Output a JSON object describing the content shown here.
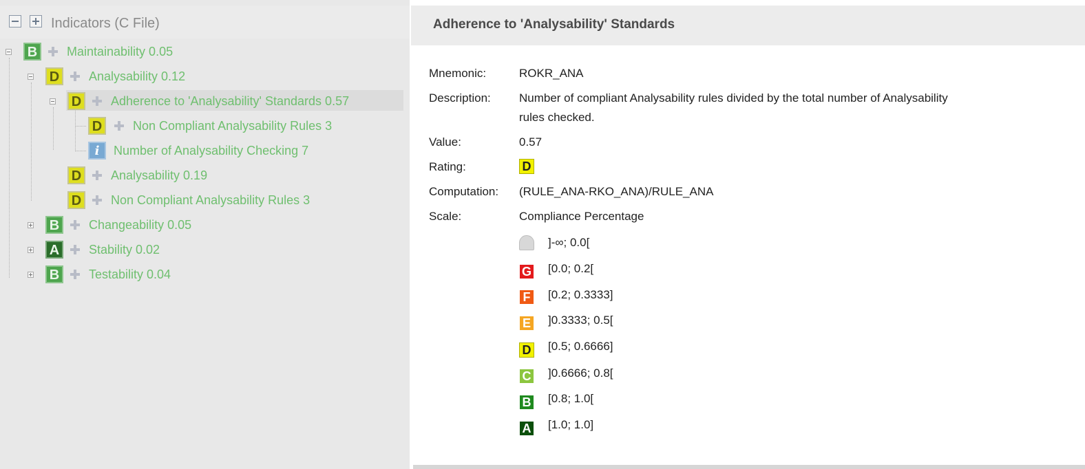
{
  "tree": {
    "header_title": "Indicators (C File)",
    "nodes": [
      {
        "rating": "B",
        "label": "Maintainability 0.05"
      },
      {
        "rating": "D",
        "label": "Analysability 0.12"
      },
      {
        "rating": "D",
        "label": "Adherence to 'Analysability' Standards 0.57"
      },
      {
        "rating": "D",
        "label": "Non Compliant Analysability Rules 3"
      },
      {
        "rating": "i",
        "label": "Number of Analysability Checking 7"
      },
      {
        "rating": "D",
        "label": "Analysability 0.19"
      },
      {
        "rating": "D",
        "label": "Non Compliant Analysability Rules 3"
      },
      {
        "rating": "B",
        "label": "Changeability 0.05"
      },
      {
        "rating": "A",
        "label": "Stability 0.02"
      },
      {
        "rating": "B",
        "label": "Testability 0.04"
      }
    ]
  },
  "detail": {
    "title": "Adherence to 'Analysability' Standards",
    "mnemonic_key": "Mnemonic:",
    "mnemonic": "ROKR_ANA",
    "description_key": "Description:",
    "description_line1": "Number of compliant Analysability rules divided by the total number of Analysability",
    "description_line2": "rules checked.",
    "value_key": "Value:",
    "value": "0.57",
    "rating_key": "Rating:",
    "rating": "D",
    "computation_key": "Computation:",
    "computation": "(RULE_ANA-RKO_ANA)/RULE_ANA",
    "scale_key": "Scale:",
    "scale": "Compliance Percentage",
    "scale_levels": [
      {
        "badge": "",
        "range": "]-∞; 0.0[",
        "color": "#c8c8c8"
      },
      {
        "badge": "G",
        "range": "[0.0; 0.2[",
        "color": "#e31a1c"
      },
      {
        "badge": "F",
        "range": "[0.2; 0.3333]",
        "color": "#f05a14"
      },
      {
        "badge": "E",
        "range": "]0.3333; 0.5[",
        "color": "#f5a623"
      },
      {
        "badge": "D",
        "range": "[0.5; 0.6666]",
        "color": "#f2f200"
      },
      {
        "badge": "C",
        "range": "]0.6666; 0.8[",
        "color": "#8cc63f"
      },
      {
        "badge": "B",
        "range": "[0.8; 1.0[",
        "color": "#1f8a1f"
      },
      {
        "badge": "A",
        "range": "[1.0; 1.0]",
        "color": "#0b4f0b"
      }
    ]
  }
}
